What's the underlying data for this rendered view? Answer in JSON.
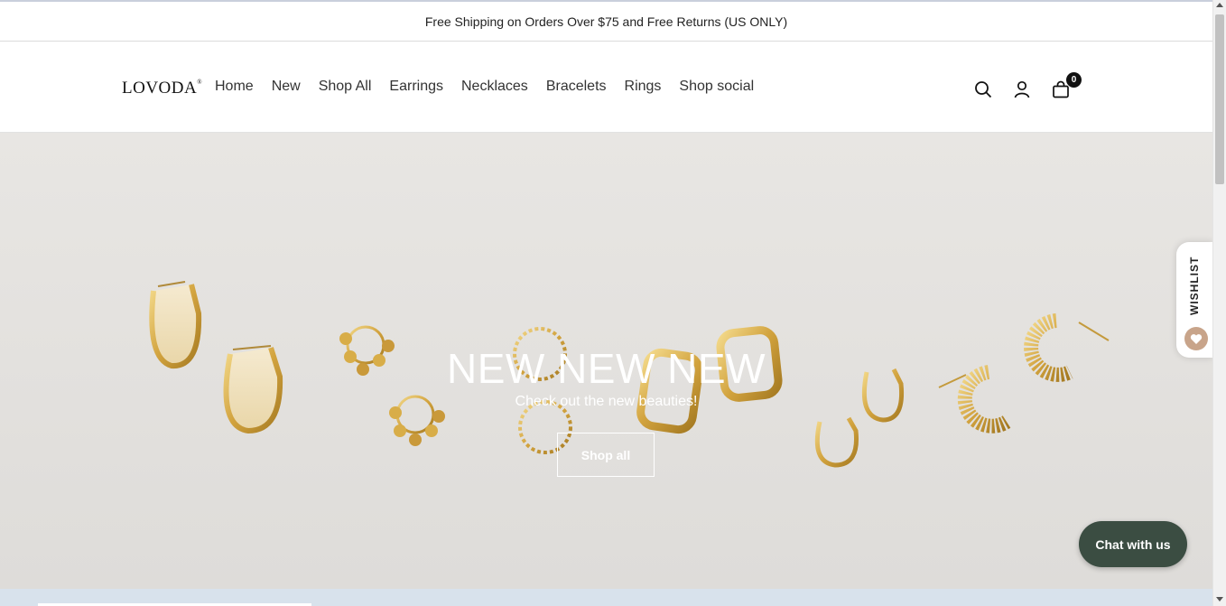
{
  "announcement": {
    "text": "Free Shipping on Orders Over $75 and Free Returns (US ONLY)"
  },
  "header": {
    "logo": "LOVODA",
    "logo_mark": "®",
    "nav": [
      "Home",
      "New",
      "Shop All",
      "Earrings",
      "Necklaces",
      "Bracelets",
      "Rings",
      "Shop social"
    ],
    "icons": [
      "search-icon",
      "account-icon",
      "cart-icon"
    ],
    "cart_count": "0"
  },
  "hero": {
    "title": "NEW NEW NEW",
    "subtitle": "Check out the new beauties!",
    "button": "Shop all"
  },
  "wishlist": {
    "label": "WISHLIST",
    "icon": "heart-icon"
  },
  "chat": {
    "label": "Chat with us"
  },
  "colors": {
    "chat_bg": "#3b4d42",
    "wishlist_heart": "#c8a48a",
    "gold": "#d9b04a"
  }
}
